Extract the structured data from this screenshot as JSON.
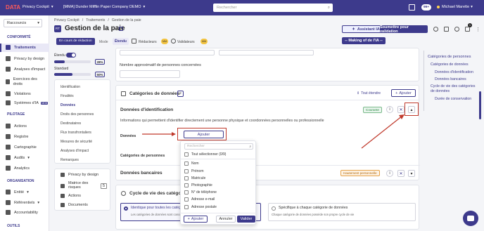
{
  "topbar": {
    "logo": "DATA",
    "app_title": "Privacy Cockpit",
    "org": "[MMA] Dunder Mifflin Paper Company DEMO",
    "search_placeholder": "Rechercher",
    "badge": "99+",
    "user": "Michael Marette"
  },
  "leftnav": {
    "shortcut": "Raccourcis",
    "sections": {
      "conformite": "CONFORMITÉ",
      "pilotage": "PILOTAGE",
      "organisation": "ORGANISATION",
      "outils": "OUTILS"
    },
    "items": {
      "traitements": "Traitements",
      "privacy": "Privacy by design",
      "analyses": "Analyses d'impact",
      "exercices": "Exercices des droits",
      "violations": "Violations",
      "systemes": "Systèmes d'IA",
      "actions": "Actions",
      "registre": "Registre",
      "cartographie": "Cartographie",
      "audits": "Audits",
      "analytics": "Analytics",
      "entite": "Entité",
      "referentiels": "Référentiels",
      "accountability": "Accountability"
    },
    "new_badge": "NEW"
  },
  "header": {
    "breadcrumb_home": "Privacy Cockpit",
    "breadcrumb_parent": "Traitements",
    "breadcrumb_current": "Gestion de la paie",
    "avatar": "RT",
    "title": "Gestion de la paie",
    "status": "En cours de rédaction",
    "mode_label": "Mode",
    "mode_value": "Étendu",
    "redacteurs": "Rédacteurs",
    "validateurs": "Validateurs",
    "initials": "MM",
    "assistant": "Assistant IA",
    "submit": "Soumettre pour validation",
    "making_of": "-- Making of de l'IA --",
    "notif_count": "1"
  },
  "progress": {
    "etendu": "Étendu",
    "standard": "Standard",
    "p1": "28%",
    "p2": "50%",
    "p1_value": 0.28,
    "p2_value": 0.5
  },
  "subnav": {
    "items": [
      "Identification",
      "Finalités",
      "Données",
      "Droits des personnes",
      "Destinataires",
      "Flux transfrontaliers",
      "Mesures de sécurité",
      "Analyses d'impact",
      "Remarques"
    ],
    "links": {
      "privacy": "Privacy by design",
      "risques": "Matrice des risques",
      "risques_count": "5",
      "actions": "Actions",
      "documents": "Documents"
    }
  },
  "main": {
    "approx_label": "Nombre approximatif de personnes concernées",
    "categories_title": "Catégories de données",
    "categories_count": "2",
    "tout_etendre": "Tout étendre",
    "ajouter": "Ajouter",
    "ident_title": "Données d'identification",
    "ident_tag": "Courante",
    "ident_desc": "Informations qui permettent d'identifier directement une personne physique et coordonnées personnelles ou professionnelle",
    "donnees_label": "Données",
    "ajouter_btn": "Ajouter",
    "categories_personnes": "Catégories de personnes",
    "bancaires_title": "Données bancaires",
    "bancaires_tag": "Hautement personnelle",
    "cycle_title": "Cycle de vie des catégories de données",
    "cycle_opt1": "Identique pour toutes les catégories de données",
    "cycle_opt1_sub": "Les catégories de données sont concernées par le même cycle de vie",
    "cycle_opt2": "Spécifique à chaque catégorie de données",
    "cycle_opt2_sub": "Chaque catégorie de données possède son propre cycle de vie"
  },
  "dropdown": {
    "search_placeholder": "Rechercher",
    "select_all": "Tout sélectionner (0/9)",
    "options": [
      "Nom",
      "Prénom",
      "Matricule",
      "Photographie",
      "N° de téléphone",
      "Adresse e-mail",
      "Adresse postale"
    ],
    "ajouter": "Ajouter",
    "annuler": "Annuler",
    "valider": "Valider"
  },
  "toc": {
    "items": [
      "Catégories de personnes",
      "Catégories de données",
      "Données d'identification",
      "Données bancaires",
      "Cycle de vie des catégories de données",
      "Durée de conservation"
    ]
  }
}
